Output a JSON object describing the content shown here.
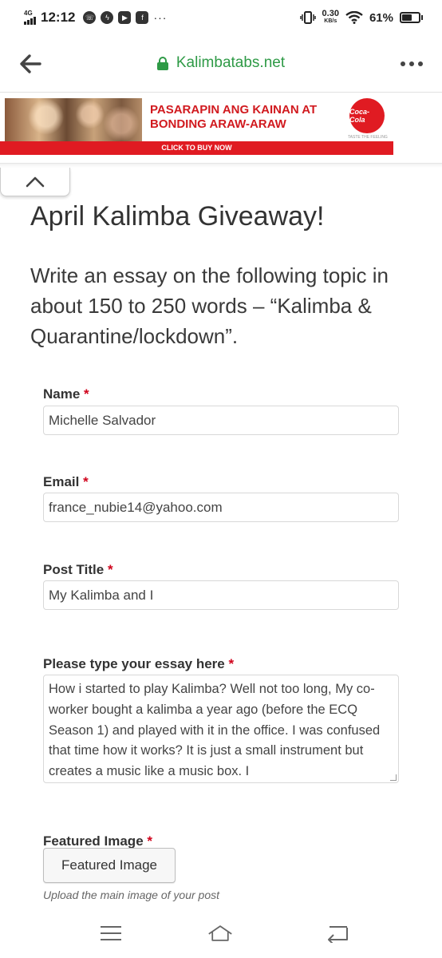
{
  "status_bar": {
    "network": "4G",
    "time": "12:12",
    "speed_value": "0.30",
    "speed_unit": "KB/s",
    "battery": "61%",
    "battery_level": 0.61,
    "notification_icons": [
      "viber-icon",
      "messenger-icon",
      "youtube-icon",
      "facebook-icon"
    ]
  },
  "browser": {
    "url": "Kalimbatabs.net",
    "accent_color": "#2e9a46"
  },
  "ad": {
    "headline_line1": "PASARAPIN ANG KAINAN AT",
    "headline_line2": "BONDING ARAW-ARAW",
    "brand": "Coca-Cola",
    "tagline": "TASTE THE FEELING",
    "cta": "CLICK TO BUY NOW",
    "brand_color": "#e01b22"
  },
  "page": {
    "title": "April Kalimba Giveaway!",
    "intro": "Write an essay on the following topic in about 150 to 250 words – “Kalimba & Quarantine/lockdown”."
  },
  "form": {
    "required_mark": "*",
    "name": {
      "label": "Name",
      "value": "Michelle Salvador"
    },
    "email": {
      "label": "Email",
      "value": "france_nubie14@yahoo.com"
    },
    "post_title": {
      "label": "Post Title",
      "value": "My Kalimba and I"
    },
    "essay": {
      "label": "Please type your essay here",
      "value": "How i started to play Kalimba? Well not too long, My co-worker bought a kalimba a year ago (before the ECQ Season 1)  and played with it in the office. I was confused that time how it works? It is just a small instrument but creates a music like a music box. I"
    },
    "featured_image": {
      "label": "Featured Image",
      "button_label": "Featured Image",
      "help": "Upload the main image of your post"
    }
  }
}
